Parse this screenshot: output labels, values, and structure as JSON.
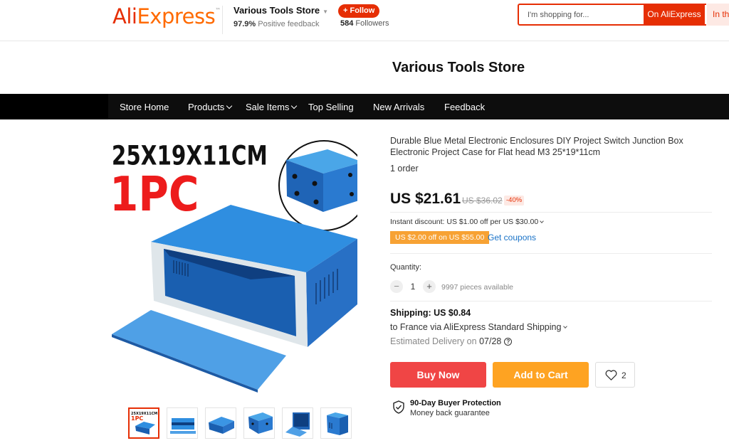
{
  "header": {
    "logo_text": "AliExpress",
    "logo_part1": "Ali",
    "logo_part2": "Express",
    "logo_tm": "™",
    "store_name": "Various Tools Store",
    "positive_feedback_value": "97.9%",
    "positive_feedback_label": "Positive feedback",
    "follow_label": "+ Follow",
    "followers_count": "584",
    "followers_label": "Followers",
    "search_placeholder": "I'm shopping for...",
    "search_button_label": "On AliExpress",
    "search_store_label": "In th"
  },
  "banner": {
    "title": "Various Tools Store"
  },
  "nav": {
    "items": [
      {
        "label": "Store Home",
        "has_dropdown": false
      },
      {
        "label": "Products",
        "has_dropdown": true
      },
      {
        "label": "Sale Items",
        "has_dropdown": true
      },
      {
        "label": "Top Selling",
        "has_dropdown": false
      },
      {
        "label": "New Arrivals",
        "has_dropdown": false
      },
      {
        "label": "Feedback",
        "has_dropdown": false
      }
    ]
  },
  "gallery": {
    "overlay_size_text": "25X19X11CM",
    "overlay_qty_text": "1PC",
    "thumbnail_count": 6,
    "active_thumbnail": 0
  },
  "product": {
    "title": "Durable Blue Metal Electronic Enclosures DIY Project Switch Junction Box Electronic Project Case for Flat head M3 25*19*11cm",
    "orders": "1 order",
    "price": "US $21.61",
    "original_price": "US $36.02",
    "discount": "-40%",
    "instant_discount": "Instant discount: US $1.00 off per US $30.00",
    "coupon": "US $2.00 off on US $55.00",
    "get_coupons_label": "Get coupons",
    "quantity_label": "Quantity:",
    "quantity_value": "1",
    "quantity_minus": "−",
    "quantity_plus": "+",
    "available": "9997 pieces available",
    "shipping_cost": "Shipping: US $0.84",
    "shipping_method": "to France via AliExpress Standard Shipping",
    "delivery_label": "Estimated Delivery on",
    "delivery_date": "07/28",
    "buy_now_label": "Buy Now",
    "add_to_cart_label": "Add to Cart",
    "wishlist_count": "2",
    "protection_title": "90-Day Buyer Protection",
    "protection_subtitle": "Money back guarantee"
  },
  "colors": {
    "brand_red": "#e62e04",
    "brand_orange": "#ff6a00",
    "buy_now": "#f04545",
    "add_to_cart": "#fea322",
    "coupon_bg": "#f7a234",
    "link_blue": "#1a73c8",
    "product_blue": "#2d7fd0"
  }
}
